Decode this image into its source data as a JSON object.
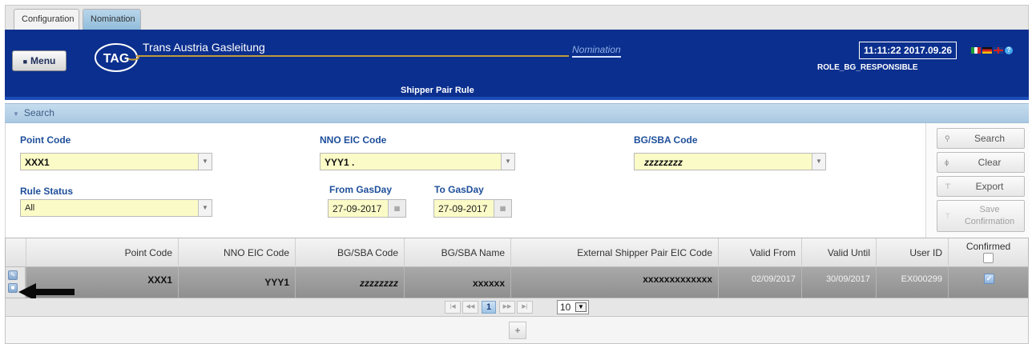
{
  "tabs": [
    "Configuration",
    "Nomination"
  ],
  "header": {
    "menu_label": "Menu",
    "logo_text": "TAG",
    "brand": "Trans Austria Gasleitung",
    "nomination_link": "Nomination",
    "clock": "11:11:22 2017.09.26",
    "role": "ROLE_BG_RESPONSIBLE",
    "page_title": "Shipper Pair Rule",
    "help_glyph": "?"
  },
  "search_panel": {
    "title": "Search",
    "point_code": {
      "label": "Point Code",
      "value": "XXX1"
    },
    "nno_eic_code": {
      "label": "NNO EIC Code",
      "value": "YYY1  ."
    },
    "bg_sba_code": {
      "label": "BG/SBA Code",
      "value": "zzzzzzzz"
    },
    "rule_status": {
      "label": "Rule Status",
      "value": "All"
    },
    "from_gasday": {
      "label": "From GasDay",
      "value": "27-09-2017"
    },
    "to_gasday": {
      "label": "To GasDay",
      "value": "27-09-2017"
    },
    "buttons": {
      "search": "Search",
      "clear": "Clear",
      "export": "Export",
      "save_confirmation_1": "Save",
      "save_confirmation_2": "Confirmation"
    }
  },
  "grid": {
    "columns": [
      "Point Code",
      "NNO EIC Code",
      "BG/SBA Code",
      "BG/SBA Name",
      "External Shipper Pair EIC Code",
      "Valid From",
      "Valid Until",
      "User ID",
      "Confirmed"
    ],
    "rows": [
      {
        "point_code": "XXX1",
        "nno_eic_code": "YYY1",
        "bg_sba_code": "zzzzzzzz",
        "bg_sba_name": "xxxxxx",
        "external_code": "xxxxxxxxxxxxx",
        "valid_from": "02/09/2017",
        "valid_until": "30/09/2017",
        "user_id": "EX000299",
        "confirmed": true
      }
    ]
  },
  "pager": {
    "current_page": "1",
    "page_size": "10"
  },
  "footer": {
    "add_glyph": "+"
  },
  "colors": {
    "header_blue": "#0b2f8e",
    "field_yellow": "#fbfbc8",
    "label_blue": "#1e4f9a",
    "accent_gold": "#c29a3a"
  }
}
